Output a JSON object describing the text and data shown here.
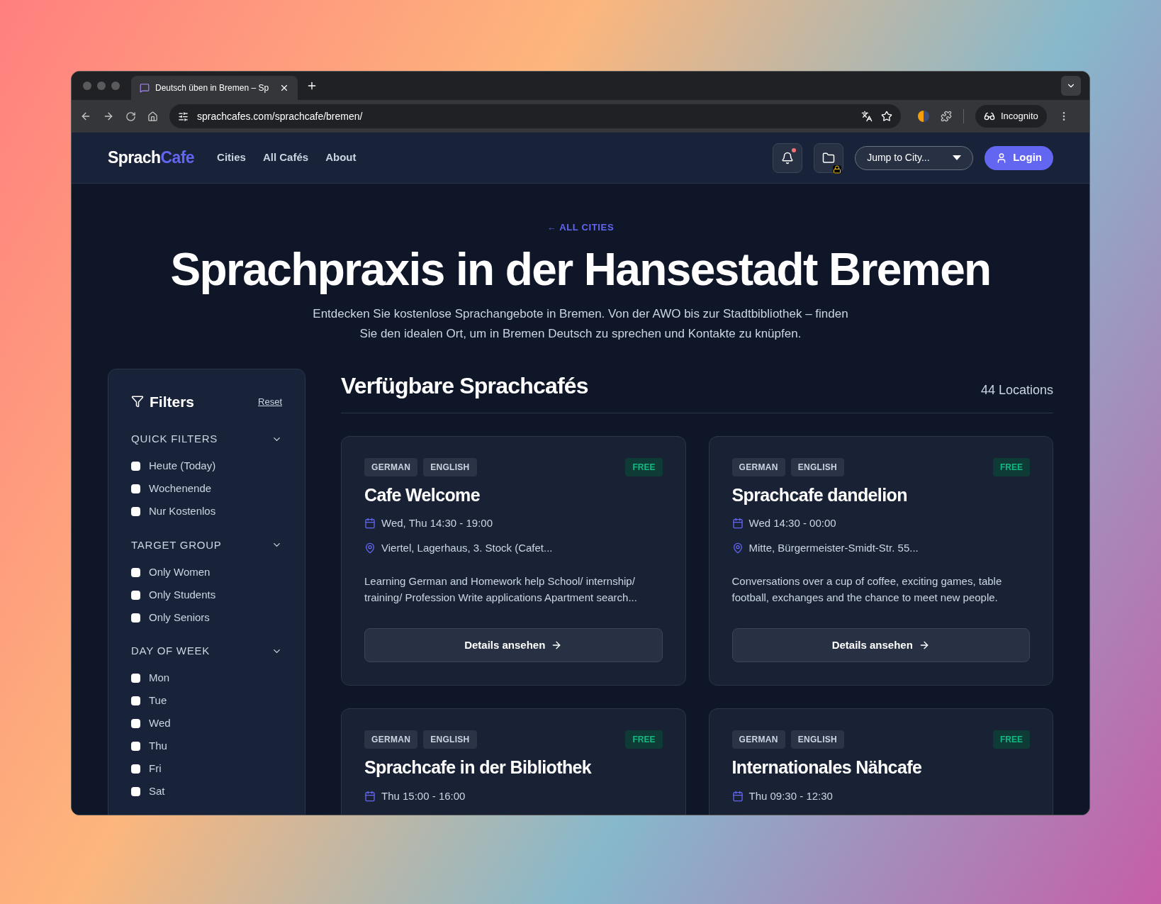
{
  "browser": {
    "tab_title": "Deutsch üben in Bremen – Sp",
    "url": "sprachcafes.com/sprachcafe/bremen/",
    "profile_label": "Incognito"
  },
  "nav": {
    "logo": [
      "Sprach",
      "Cafe"
    ],
    "links": [
      "Cities",
      "All Cafés",
      "About"
    ],
    "has_notification": true,
    "city_select": {
      "placeholder": "Jump to City..."
    },
    "login": "Login"
  },
  "hero": {
    "back_link": "← ALL CITIES",
    "title": "Sprachpraxis in der Hansestadt Bremen",
    "description": "Entdecken Sie kostenlose Sprachangebote in Bremen. Von der AWO bis zur Stadtbibliothek – finden Sie den idealen Ort, um in Bremen Deutsch zu sprechen und Kontakte zu knüpfen."
  },
  "filters": {
    "title": "Filters",
    "reset": "Reset",
    "sections": [
      {
        "title": "QUICK FILTERS",
        "expanded": true,
        "options": [
          {
            "label": "Heute (Today)",
            "checked": false
          },
          {
            "label": "Wochenende",
            "checked": false
          },
          {
            "label": "Nur Kostenlos",
            "checked": false
          }
        ]
      },
      {
        "title": "TARGET GROUP",
        "expanded": true,
        "options": [
          {
            "label": "Only Women",
            "checked": false
          },
          {
            "label": "Only Students",
            "checked": false
          },
          {
            "label": "Only Seniors",
            "checked": false
          }
        ]
      },
      {
        "title": "DAY OF WEEK",
        "expanded": true,
        "options": [
          {
            "label": "Mon",
            "checked": false
          },
          {
            "label": "Tue",
            "checked": false
          },
          {
            "label": "Wed",
            "checked": false
          },
          {
            "label": "Thu",
            "checked": false
          },
          {
            "label": "Fri",
            "checked": false
          },
          {
            "label": "Sat",
            "checked": false
          }
        ]
      }
    ]
  },
  "results": {
    "heading": "Verfügbare Sprachcafés",
    "count": "44 Locations"
  },
  "cards": [
    {
      "tags": [
        "GERMAN",
        "ENGLISH"
      ],
      "price": "FREE",
      "title": "Cafe Welcome",
      "schedule": "Wed, Thu 14:30 - 19:00",
      "location": "Viertel, Lagerhaus, 3. Stock (Cafet...",
      "description": "Learning German and Homework help School/ internship/ training/ Profession Write applications Apartment search...",
      "button": "Details ansehen"
    },
    {
      "tags": [
        "GERMAN",
        "ENGLISH"
      ],
      "price": "FREE",
      "title": "Sprachcafe dandelion",
      "schedule": "Wed 14:30 - 00:00",
      "location": "Mitte, Bürgermeister-Smidt-Str. 55...",
      "description": "Conversations over a cup of coffee, exciting games, table football, exchanges and the chance to meet new people.",
      "button": "Details ansehen"
    },
    {
      "tags": [
        "GERMAN",
        "ENGLISH"
      ],
      "price": "FREE",
      "title": "Sprachcafe in der Bibliothek",
      "schedule": "Thu 15:00 - 16:00"
    },
    {
      "tags": [
        "GERMAN",
        "ENGLISH"
      ],
      "price": "FREE",
      "title": "Internationales Nähcafe",
      "schedule": "Thu 09:30 - 12:30"
    }
  ]
}
